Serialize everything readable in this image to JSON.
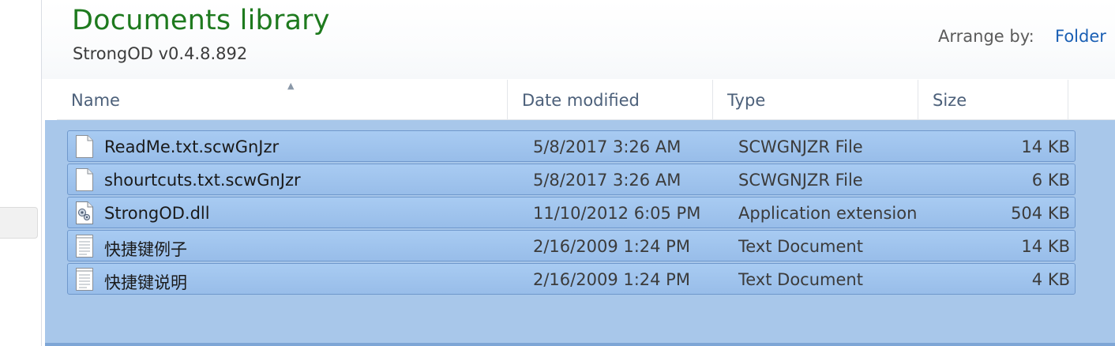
{
  "library": {
    "title": "Documents library",
    "subtitle": "StrongOD v0.4.8.892",
    "arrange_by_label": "Arrange by:",
    "arrange_by_value": "Folder"
  },
  "columns": {
    "name": "Name",
    "date": "Date modified",
    "type": "Type",
    "size": "Size"
  },
  "files": [
    {
      "name": "ReadMe.txt.scwGnJzr",
      "date": "5/8/2017 3:26 AM",
      "type": "SCWGNJZR File",
      "size": "14 KB",
      "icon": "blank-file-icon",
      "selected": true
    },
    {
      "name": "shourtcuts.txt.scwGnJzr",
      "date": "5/8/2017 3:26 AM",
      "type": "SCWGNJZR File",
      "size": "6 KB",
      "icon": "blank-file-icon",
      "selected": true
    },
    {
      "name": "StrongOD.dll",
      "date": "11/10/2012 6:05 PM",
      "type": "Application extension",
      "size": "504 KB",
      "icon": "dll-file-icon",
      "selected": true
    },
    {
      "name": "快捷键例子",
      "date": "2/16/2009 1:24 PM",
      "type": "Text Document",
      "size": "14 KB",
      "icon": "text-document-icon",
      "selected": true
    },
    {
      "name": "快捷键说明",
      "date": "2/16/2009 1:24 PM",
      "type": "Text Document",
      "size": "4 KB",
      "icon": "text-document-icon",
      "selected": true
    }
  ],
  "colors": {
    "title_green": "#1e7a1e",
    "link_blue": "#1a5fb4",
    "selection_fill": "#a8c7ea",
    "selection_border": "#6f98cc"
  }
}
